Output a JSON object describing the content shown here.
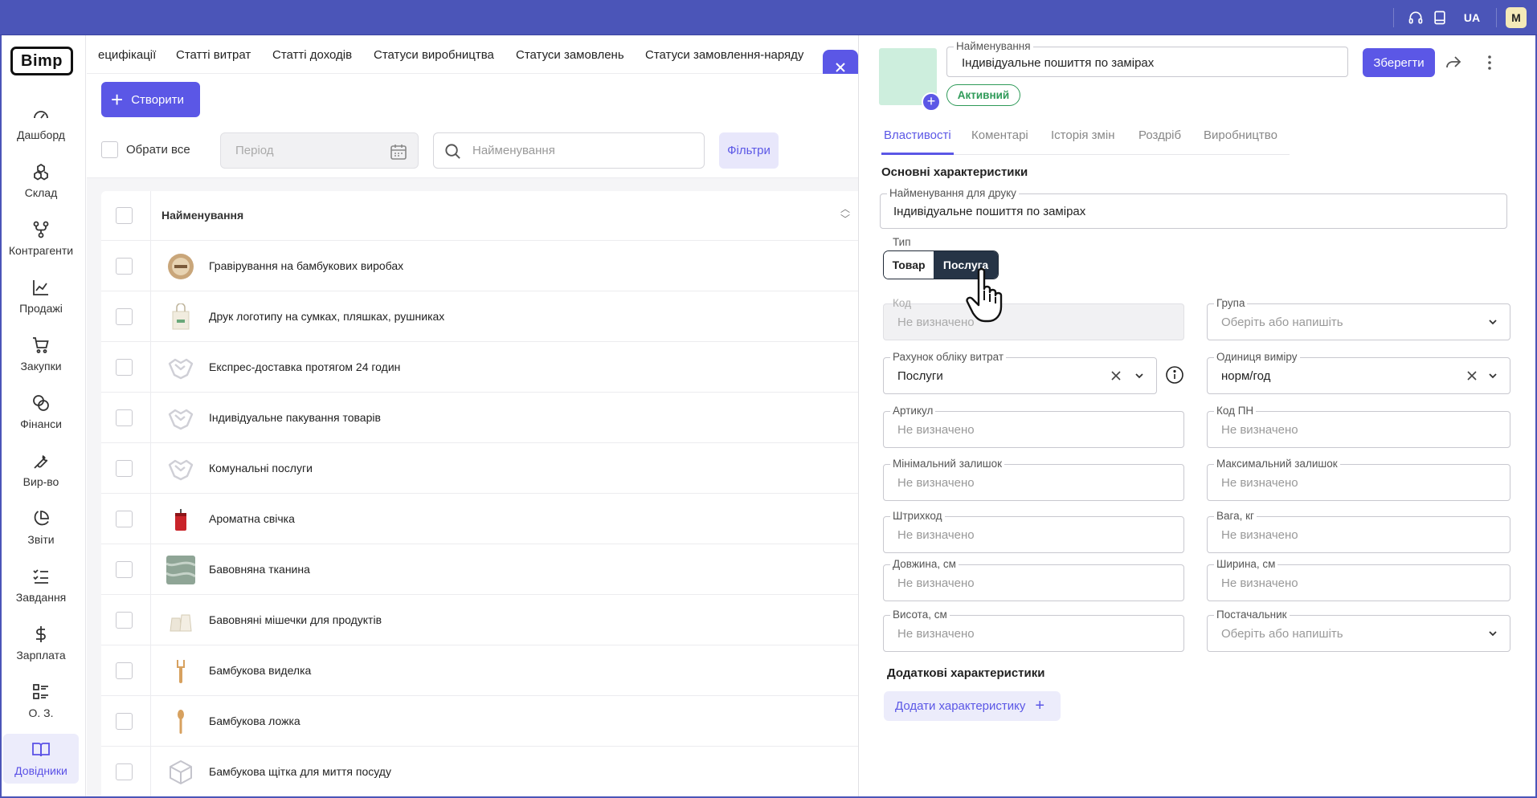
{
  "topbar": {
    "lang": "UA",
    "user_initial": "M"
  },
  "sidebar": {
    "logo": "Bimp",
    "items": [
      {
        "label": "Дашборд",
        "icon": "gauge-icon"
      },
      {
        "label": "Склад",
        "icon": "boxes-icon"
      },
      {
        "label": "Контрагенти",
        "icon": "network-icon"
      },
      {
        "label": "Продажі",
        "icon": "line-chart-icon"
      },
      {
        "label": "Закупки",
        "icon": "cart-icon"
      },
      {
        "label": "Фінанси",
        "icon": "coins-icon"
      },
      {
        "label": "Вир-во",
        "icon": "wrench-icon"
      },
      {
        "label": "Звіти",
        "icon": "pie-chart-icon"
      },
      {
        "label": "Завдання",
        "icon": "checklist-icon"
      },
      {
        "label": "Зарплата",
        "icon": "dollar-icon"
      },
      {
        "label": "О. З.",
        "icon": "assets-icon"
      },
      {
        "label": "Довідники",
        "icon": "book-open-icon",
        "active": true
      }
    ]
  },
  "subtabs": [
    "ецифікації",
    "Статті витрат",
    "Статті доходів",
    "Статуси виробництва",
    "Статуси замовлень",
    "Статуси замовлення-наряду"
  ],
  "toolbar": {
    "create_label": "Створити",
    "select_all_label": "Обрати все",
    "period_placeholder": "Період",
    "search_placeholder": "Найменування",
    "filters_label": "Фільтри"
  },
  "table": {
    "header": "Найменування",
    "rows": [
      {
        "name": "Гравірування на бамбукових виробах",
        "thumb": "badge"
      },
      {
        "name": "Друк логотипу на сумках, пляшках, рушниках",
        "thumb": "bag"
      },
      {
        "name": "Експрес-доставка протягом 24 годин",
        "thumb": "handshake"
      },
      {
        "name": "Індивідуальне пакування товарів",
        "thumb": "handshake"
      },
      {
        "name": "Комунальні послуги",
        "thumb": "handshake"
      },
      {
        "name": "Ароматна свічка",
        "thumb": "candle"
      },
      {
        "name": "Бавовняна тканина",
        "thumb": "fabric"
      },
      {
        "name": "Бавовняні мішечки для продуктів",
        "thumb": "sacks"
      },
      {
        "name": "Бамбукова виделка",
        "thumb": "fork"
      },
      {
        "name": "Бамбукова ложка",
        "thumb": "spoon"
      },
      {
        "name": "Бамбукова щітка для миття посуду",
        "thumb": "box"
      }
    ]
  },
  "panel": {
    "name_label": "Найменування",
    "name_value": "Індивідуальне пошиття по замірах",
    "save_label": "Зберегти",
    "status": "Активний",
    "tabs": [
      "Властивості",
      "Коментарі",
      "Історія змін",
      "Роздріб",
      "Виробництво"
    ],
    "section_main": "Основні характеристики",
    "print_name_label": "Найменування для друку",
    "print_name_value": "Індивідуальне пошиття по замірах",
    "type_label": "Тип",
    "type_options": [
      "Товар",
      "Послуга"
    ],
    "type_selected": "Послуга",
    "code_label": "Код",
    "code_placeholder": "Не визначено",
    "group_label": "Група",
    "group_placeholder": "Оберіть або напишіть",
    "expense_label": "Рахунок обліку витрат",
    "expense_value": "Послуги",
    "unit_label": "Одиниця виміру",
    "unit_value": "норм/год",
    "article_label": "Артикул",
    "article_placeholder": "Не визначено",
    "pn_label": "Код ПН",
    "pn_placeholder": "Не визначено",
    "min_label": "Мінімальний залишок",
    "min_placeholder": "Не визначено",
    "max_label": "Максимальний залишок",
    "max_placeholder": "Не визначено",
    "barcode_label": "Штрихкод",
    "barcode_placeholder": "Не визначено",
    "weight_label": "Вага, кг",
    "weight_placeholder": "Не визначено",
    "length_label": "Довжина, см",
    "length_placeholder": "Не визначено",
    "width_label": "Ширина, см",
    "width_placeholder": "Не визначено",
    "height_label": "Висота, см",
    "height_placeholder": "Не визначено",
    "supplier_label": "Постачальник",
    "supplier_placeholder": "Оберіть або напишіть",
    "section_extra": "Додаткові характеристики",
    "add_char_label": "Додати характеристику"
  },
  "colors": {
    "accent": "#5b57e6",
    "topbar": "#4b55b8",
    "active_green": "#2e9a58",
    "dark_toggle": "#263446"
  }
}
